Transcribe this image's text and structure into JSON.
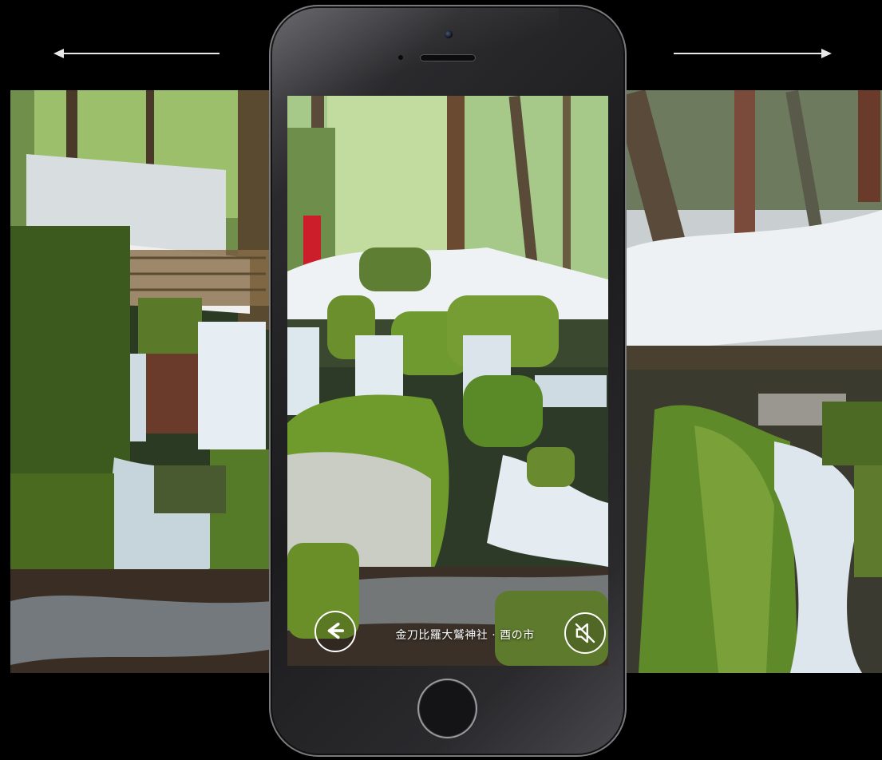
{
  "navigation": {
    "left_arrow_icon": "arrow-left-icon",
    "right_arrow_icon": "arrow-right-icon"
  },
  "phone": {
    "caption": "金刀比羅大鷲神社 · 酉の市",
    "back_button_icon": "arrow-left-circle-icon",
    "mute_button_icon": "speaker-muted-icon"
  },
  "colors": {
    "background": "#000000",
    "moss": "#4f7a22",
    "snow": "#e9eef2",
    "water": "#d8e4ec"
  }
}
